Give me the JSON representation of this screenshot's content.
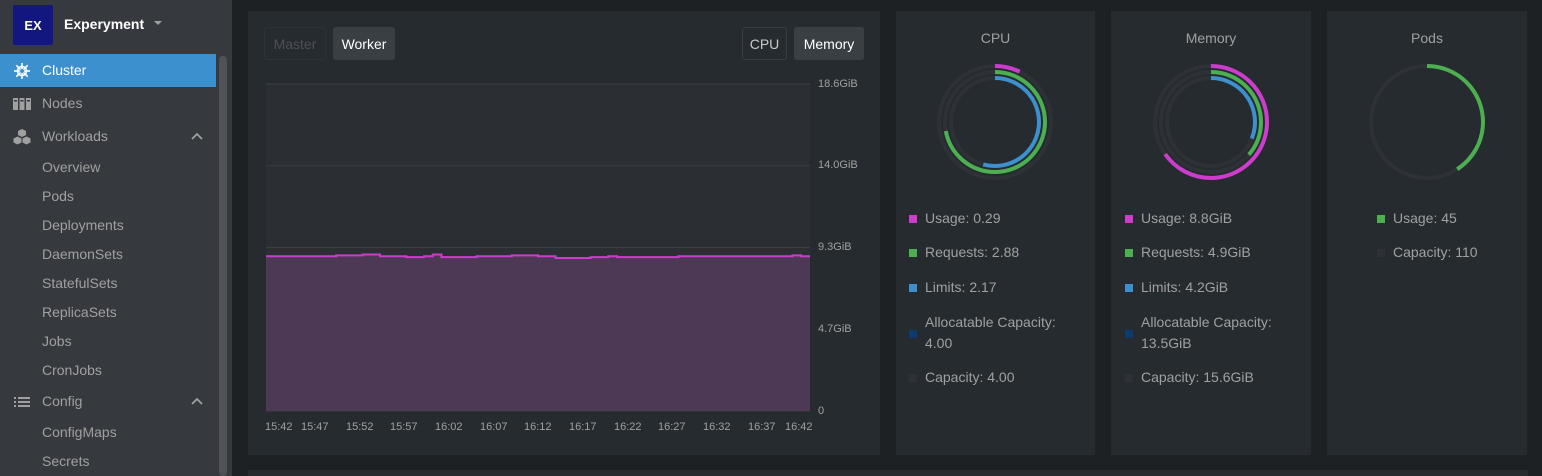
{
  "colors": {
    "accent": "#3d90ce",
    "usage": "#ce3ccd",
    "requests": "#4caf50",
    "limits": "#3d90ce",
    "allocatable": "#0d3b6e",
    "capacity": "#2e3236"
  },
  "sidebar": {
    "avatar_initials": "EX",
    "cluster_name": "Experyment",
    "items": [
      {
        "label": "Cluster",
        "icon": "helm-icon"
      },
      {
        "label": "Nodes",
        "icon": "server-icon"
      },
      {
        "label": "Workloads",
        "icon": "cubes-icon"
      },
      {
        "label": "Config",
        "icon": "list-icon"
      }
    ],
    "workloads_sub": [
      "Overview",
      "Pods",
      "Deployments",
      "DaemonSets",
      "StatefulSets",
      "ReplicaSets",
      "Jobs",
      "CronJobs"
    ],
    "config_sub": [
      "ConfigMaps",
      "Secrets"
    ]
  },
  "main": {
    "node_tabs": [
      "Master",
      "Worker"
    ],
    "active_node_tab": "Worker",
    "metric_tabs": [
      "CPU",
      "Memory"
    ],
    "active_metric_tab": "Memory"
  },
  "chart_data": {
    "type": "area",
    "y_ticks": [
      "18.6GiB",
      "14.0GiB",
      "9.3GiB",
      "4.7GiB",
      "0"
    ],
    "ylim": [
      0,
      18.6
    ],
    "x_ticks": [
      "15:42",
      "15:47",
      "15:52",
      "15:57",
      "16:02",
      "16:07",
      "16:12",
      "16:17",
      "16:22",
      "16:27",
      "16:32",
      "16:37",
      "16:42"
    ],
    "series": [
      {
        "color": "#ce3ccd",
        "values": [
          8.8,
          8.8,
          8.8,
          8.8,
          8.8,
          8.8,
          8.8,
          8.8,
          8.85,
          8.85,
          8.85,
          8.9,
          8.9,
          8.8,
          8.8,
          8.8,
          8.75,
          8.75,
          8.8,
          8.9,
          8.75,
          8.75,
          8.75,
          8.75,
          8.8,
          8.8,
          8.8,
          8.8,
          8.85,
          8.85,
          8.85,
          8.8,
          8.8,
          8.7,
          8.7,
          8.7,
          8.7,
          8.75,
          8.75,
          8.8,
          8.75,
          8.75,
          8.75,
          8.75,
          8.75,
          8.75,
          8.75,
          8.8,
          8.8,
          8.8,
          8.8,
          8.8,
          8.8,
          8.8,
          8.8,
          8.8,
          8.8,
          8.8,
          8.8,
          8.8,
          8.85,
          8.8,
          8.8
        ]
      }
    ]
  },
  "cpu": {
    "title": "CPU",
    "legend": [
      {
        "label": "Usage: 0.29",
        "color": "#ce3ccd"
      },
      {
        "label": "Requests: 2.88",
        "color": "#4caf50"
      },
      {
        "label": "Limits: 2.17",
        "color": "#3d90ce"
      },
      {
        "label": "Allocatable Capacity: 4.00",
        "color": "#0d3b6e"
      },
      {
        "label": "Capacity: 4.00",
        "color": "#2e3236"
      }
    ],
    "rings": {
      "usage": 0.0725,
      "requests": 0.72,
      "limits": 0.5425
    }
  },
  "memory": {
    "title": "Memory",
    "legend": [
      {
        "label": "Usage: 8.8GiB",
        "color": "#ce3ccd"
      },
      {
        "label": "Requests: 4.9GiB",
        "color": "#4caf50"
      },
      {
        "label": "Limits: 4.2GiB",
        "color": "#3d90ce"
      },
      {
        "label": "Allocatable Capacity: 13.5GiB",
        "color": "#0d3b6e"
      },
      {
        "label": "Capacity: 15.6GiB",
        "color": "#2e3236"
      }
    ],
    "rings": {
      "usage": 0.652,
      "requests": 0.363,
      "limits": 0.311
    }
  },
  "pods": {
    "title": "Pods",
    "legend": [
      {
        "label": "Usage: 45",
        "color": "#4caf50"
      },
      {
        "label": "Capacity: 110",
        "color": "#2e3236"
      }
    ],
    "rings": {
      "usage": 0.409
    }
  }
}
